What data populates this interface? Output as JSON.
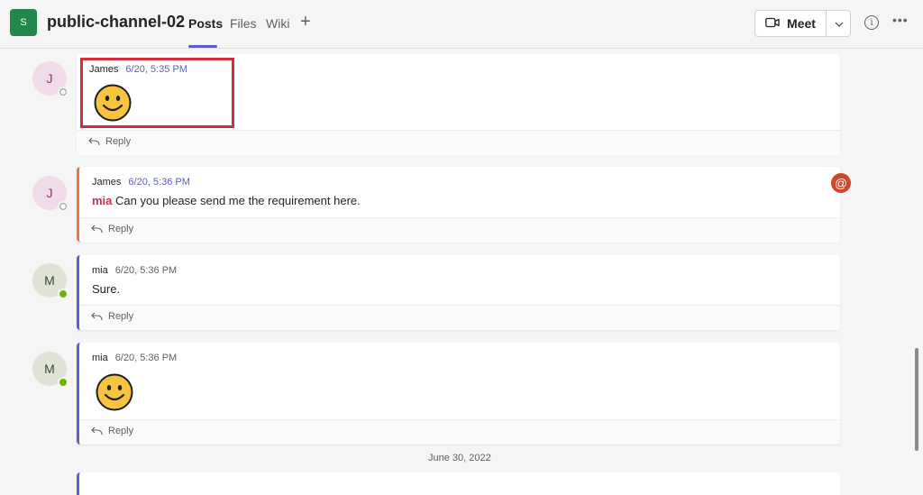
{
  "header": {
    "team_initial": "S",
    "channel_title": "public-channel-02",
    "tabs": [
      {
        "label": "Posts",
        "active": true
      },
      {
        "label": "Files",
        "active": false
      },
      {
        "label": "Wiki",
        "active": false
      }
    ],
    "add_tab_symbol": "+",
    "meet_label": "Meet",
    "accent_color": "#5b5fc7"
  },
  "messages": [
    {
      "avatar_initial": "J",
      "presence": "offline",
      "author": "James",
      "time": "6/20, 5:35 PM",
      "text": "",
      "has_emoji": true,
      "reply_label": "Reply"
    },
    {
      "avatar_initial": "J",
      "presence": "offline",
      "author": "James",
      "time": "6/20, 5:36 PM",
      "mention": "mia",
      "text": "Can you please send me the requirement here.",
      "has_emoji": false,
      "reply_label": "Reply"
    },
    {
      "avatar_initial": "M",
      "presence": "online",
      "author": "mia",
      "time": "6/20, 5:36 PM",
      "text": "Sure.",
      "has_emoji": false,
      "reply_label": "Reply"
    },
    {
      "avatar_initial": "M",
      "presence": "online",
      "author": "mia",
      "time": "6/20, 5:36 PM",
      "text": "",
      "has_emoji": true,
      "reply_label": "Reply"
    }
  ],
  "mention_badge": "@",
  "date_divider": "June 30, 2022",
  "icons": [
    "video-camera-icon",
    "chevron-down-icon",
    "info-icon",
    "more-options-icon",
    "reply-arrow-icon",
    "smiley-emoji-icon",
    "at-mention-icon"
  ]
}
